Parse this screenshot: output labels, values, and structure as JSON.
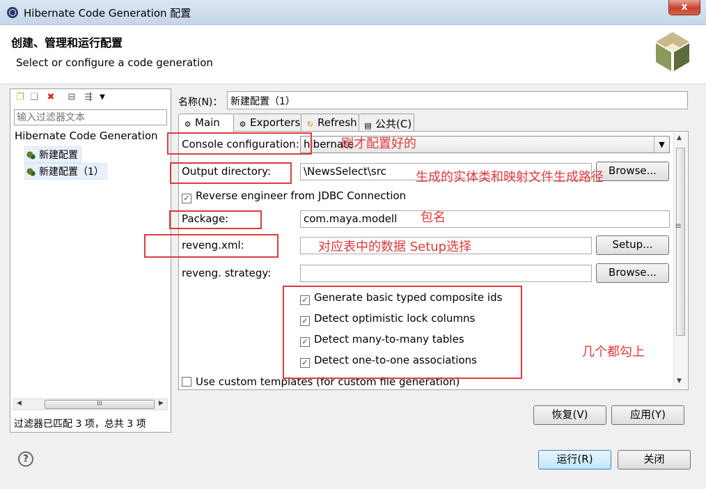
{
  "window": {
    "title": "Hibernate Code Generation 配置",
    "close_glyph": "x"
  },
  "header": {
    "title": "创建、管理和运行配置",
    "subtitle": "Select or configure a code generation"
  },
  "left_panel": {
    "filter_placeholder": "输入过滤器文本",
    "tree_root": "Hibernate Code Generation",
    "tree_items": [
      "新建配置",
      "新建配置（1）"
    ],
    "scroll_grip": "III",
    "status": "过滤器已匹配 3 项，总共 3 项"
  },
  "config": {
    "name_label": "名称(N)：",
    "name_value": "新建配置（1）",
    "tabs": [
      "Main",
      "Exporters",
      "Refresh",
      "公共(C)"
    ]
  },
  "main": {
    "console_label": "Console configuration:",
    "console_value": "hibernate",
    "output_label": "Output directory:",
    "output_value": "\\NewsSelect\\src",
    "browse_label": "Browse...",
    "reverse_label": "Reverse engineer from JDBC Connection",
    "package_label": "Package:",
    "package_value": "com.maya.modell",
    "reveng_label": "reveng.xml:",
    "setup_label": "Setup...",
    "strategy_label": "reveng. strategy:",
    "options": [
      "Generate basic typed composite ids",
      "Detect optimistic lock columns",
      "Detect many-to-many tables",
      "Detect one-to-one associations"
    ],
    "custom_templates_label": "Use custom templates (for custom file generation)"
  },
  "annotations": {
    "console_note": "刚才配置好的",
    "output_note": "生成的实体类和映射文件生成路径",
    "package_note": "包名",
    "reveng_note": "对应表中的数据 Setup选择",
    "options_note": "几个都勾上"
  },
  "buttons": {
    "revert": "恢复(V)",
    "apply": "应用(Y)",
    "run": "运行(R)",
    "close": "关闭"
  },
  "help_glyph": "?",
  "colors": {
    "annotation_red": "#e0393b",
    "primary_button": "#bee6fd"
  }
}
